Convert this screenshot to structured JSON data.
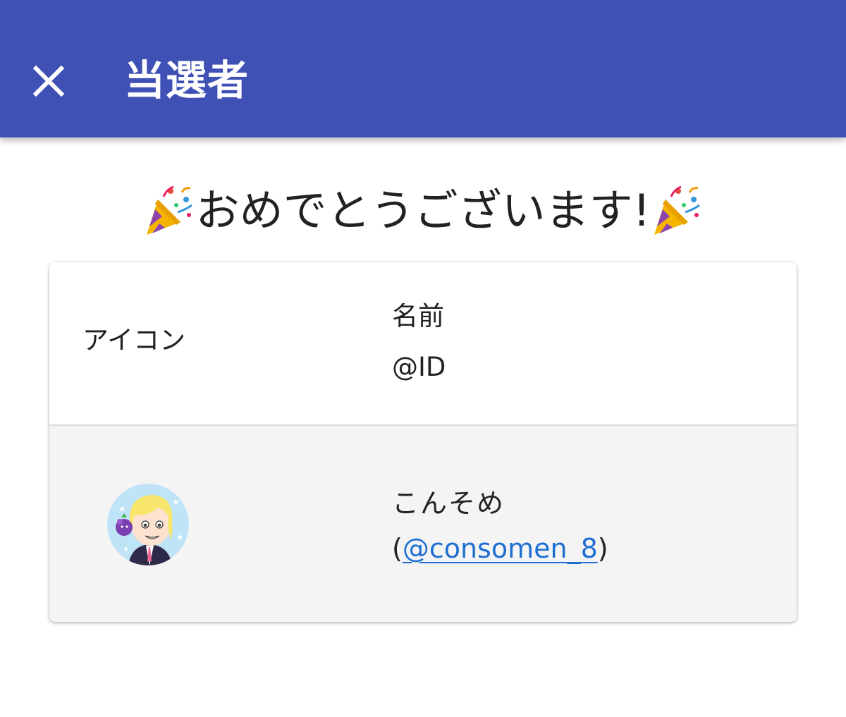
{
  "app_bar": {
    "title": "当選者",
    "background_color": "#3f51b5",
    "close_icon": "close-icon"
  },
  "headline": {
    "text": "おめでとうございます!",
    "decoration_icon": "party-popper-icon"
  },
  "table": {
    "headers": {
      "icon": "アイコン",
      "name": "名前",
      "id": "@ID"
    },
    "rows": [
      {
        "avatar": "user-avatar",
        "name": "こんそめ",
        "id_open": "(",
        "id": "@consomen_8",
        "id_close": ")"
      }
    ]
  },
  "colors": {
    "link": "#1f6fd1",
    "row_background": "#f4f4f4"
  }
}
